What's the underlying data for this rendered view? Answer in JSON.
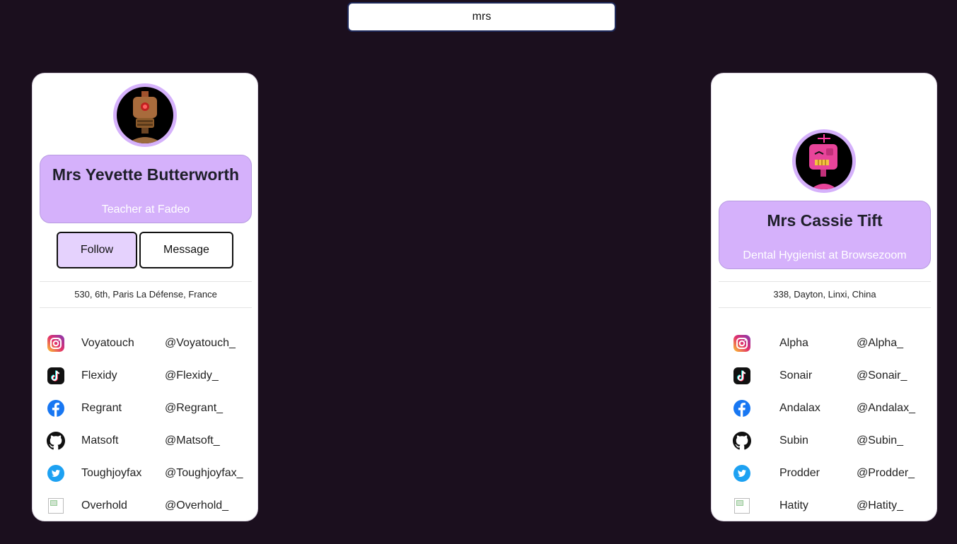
{
  "search": {
    "value": "mrs",
    "placeholder": ""
  },
  "profiles": [
    {
      "name": "Mrs Yevette Butterworth",
      "job": "Teacher at Fadeo",
      "follow_label": "Follow",
      "message_label": "Message",
      "address": "530, 6th, Paris La Défense, France",
      "avatar_icon": "robot-avatar-brown",
      "socials": [
        {
          "icon": "instagram-icon",
          "name": "Voyatouch",
          "handle": "@Voyatouch_"
        },
        {
          "icon": "tiktok-icon",
          "name": "Flexidy",
          "handle": "@Flexidy_"
        },
        {
          "icon": "facebook-icon",
          "name": "Regrant",
          "handle": "@Regrant_"
        },
        {
          "icon": "github-icon",
          "name": "Matsoft",
          "handle": "@Matsoft_"
        },
        {
          "icon": "twitter-icon",
          "name": "Toughjoyfax",
          "handle": "@Toughjoyfax_"
        },
        {
          "icon": "broken-image-icon",
          "name": "Overhold",
          "handle": "@Overhold_"
        }
      ]
    },
    {
      "name": "Mrs Cassie Tift",
      "job": "Dental Hygienist at Browsezoom",
      "address": "338, Dayton, Linxi, China",
      "avatar_icon": "robot-avatar-pink",
      "socials": [
        {
          "icon": "instagram-icon",
          "name": "Alpha",
          "handle": "@Alpha_"
        },
        {
          "icon": "tiktok-icon",
          "name": "Sonair",
          "handle": "@Sonair_"
        },
        {
          "icon": "facebook-icon",
          "name": "Andalax",
          "handle": "@Andalax_"
        },
        {
          "icon": "github-icon",
          "name": "Subin",
          "handle": "@Subin_"
        },
        {
          "icon": "twitter-icon",
          "name": "Prodder",
          "handle": "@Prodder_"
        },
        {
          "icon": "broken-image-icon",
          "name": "Hatity",
          "handle": "@Hatity_"
        }
      ]
    }
  ],
  "colors": {
    "background": "#1b0f1e",
    "accent": "#d5b1fb",
    "follow_button": "#e5d2fd"
  }
}
